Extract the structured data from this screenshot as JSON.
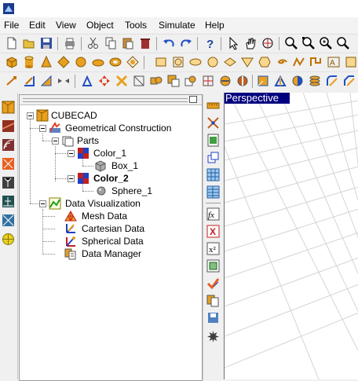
{
  "menu": {
    "items": [
      "File",
      "Edit",
      "View",
      "Object",
      "Tools",
      "Simulate",
      "Help"
    ]
  },
  "tree": {
    "root": {
      "label": "CUBECAD"
    },
    "geometrical_construction": {
      "label": "Geometrical Construction"
    },
    "parts": {
      "label": "Parts"
    },
    "color_1": {
      "label": "Color_1"
    },
    "box_1": {
      "label": "Box_1"
    },
    "color_2": {
      "label": "Color_2"
    },
    "sphere_1": {
      "label": "Sphere_1"
    },
    "data_visualization": {
      "label": "Data Visualization"
    },
    "mesh_data": {
      "label": "Mesh Data"
    },
    "cartesian_data": {
      "label": "Cartesian Data"
    },
    "spherical_data": {
      "label": "Spherical Data"
    },
    "data_manager": {
      "label": "Data Manager"
    }
  },
  "viewport": {
    "label": "Perspective"
  },
  "colors": {
    "viewport_label_bg": "#00007f",
    "grid_line": "#d4d4d4",
    "selection_accent": "#0a64c8"
  }
}
